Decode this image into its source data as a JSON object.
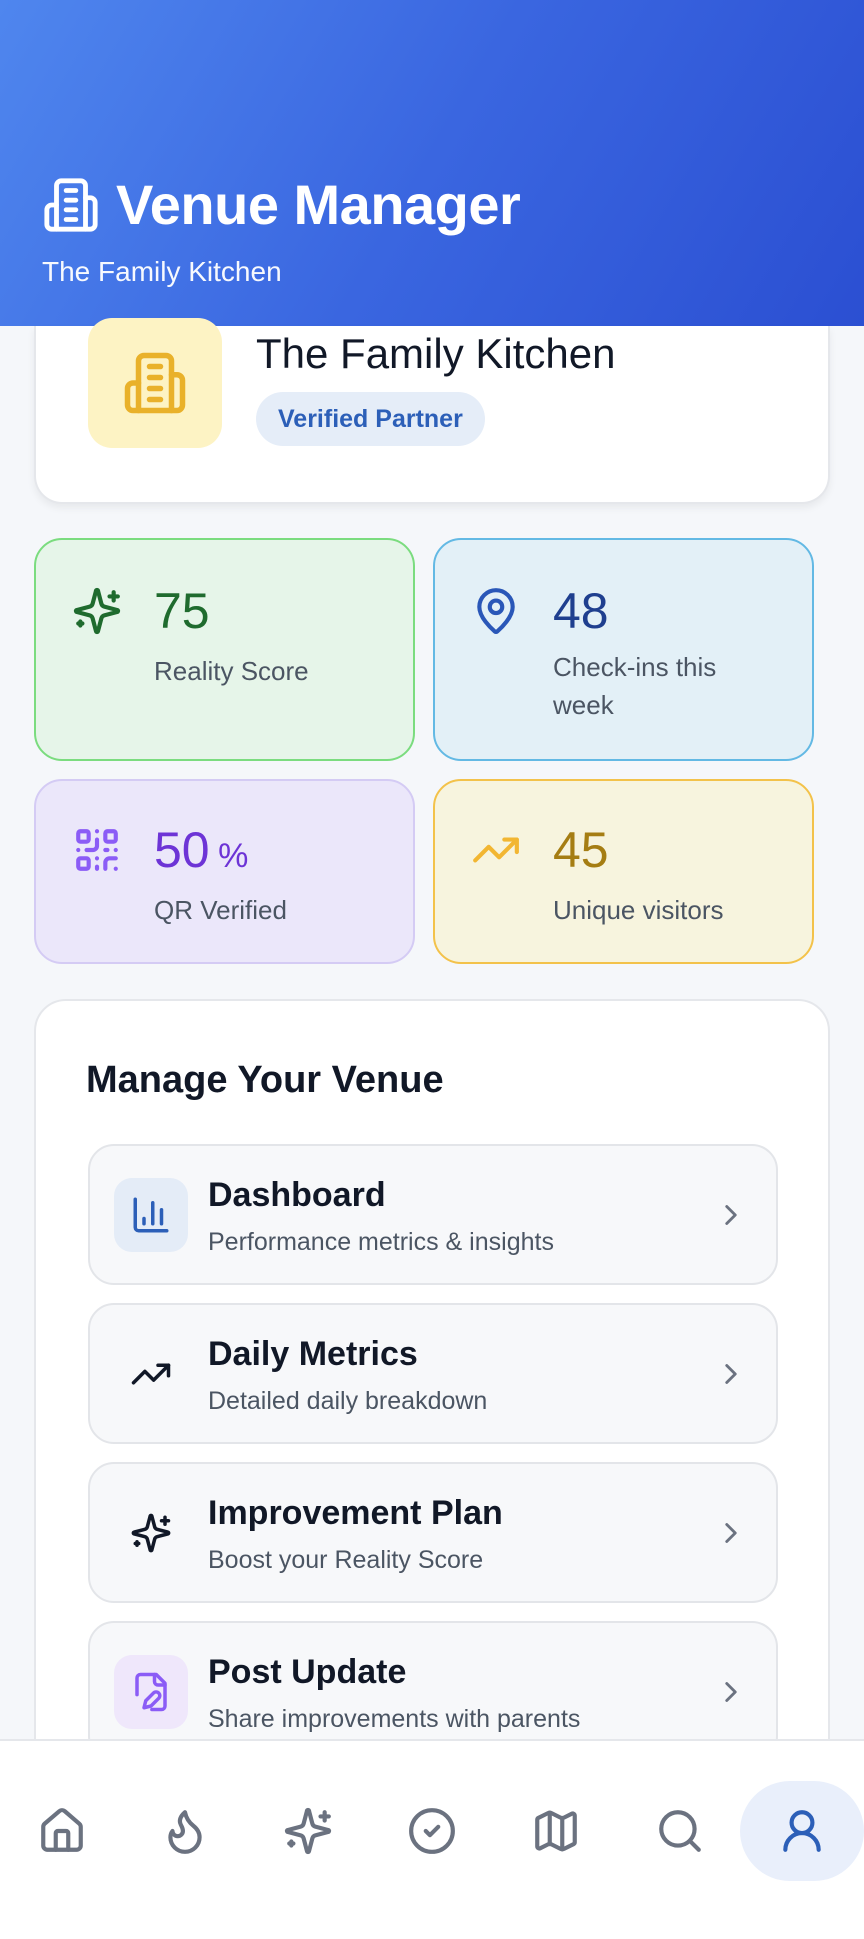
{
  "header": {
    "title": "Venue Manager",
    "subtitle": "The Family Kitchen",
    "icon": "building-icon"
  },
  "venue": {
    "name": "The Family Kitchen",
    "badge": "Verified Partner",
    "icon": "building-icon"
  },
  "stats": [
    {
      "value": "75",
      "unit": "",
      "label": "Reality Score",
      "icon": "sparkles-icon",
      "color": "#1f6b2e"
    },
    {
      "value": "48",
      "unit": "",
      "label": "Check-ins this week",
      "icon": "map-pin-icon",
      "color": "#1f3f8f"
    },
    {
      "value": "50",
      "unit": "%",
      "label": "QR Verified",
      "icon": "qr-code-icon",
      "color": "#6d34d6"
    },
    {
      "value": "45",
      "unit": "",
      "label": "Unique visitors",
      "icon": "trending-up-icon",
      "color": "#a57d13"
    }
  ],
  "manage": {
    "title": "Manage Your Venue",
    "items": [
      {
        "title": "Dashboard",
        "desc": "Performance metrics & insights",
        "icon": "bar-chart-icon"
      },
      {
        "title": "Daily Metrics",
        "desc": "Detailed daily breakdown",
        "icon": "trending-up-icon"
      },
      {
        "title": "Improvement Plan",
        "desc": "Boost your Reality Score",
        "icon": "sparkles-icon"
      },
      {
        "title": "Post Update",
        "desc": "Share improvements with parents",
        "icon": "file-edit-icon"
      }
    ]
  },
  "nav": {
    "items": [
      "home-icon",
      "flame-icon",
      "sparkles-icon",
      "check-circle-icon",
      "map-icon",
      "search-icon",
      "user-icon"
    ],
    "active": "user-icon"
  },
  "colors": {
    "header_start": "#4f86ee",
    "header_end": "#2b4fd2",
    "accent": "#2c5fb8"
  }
}
